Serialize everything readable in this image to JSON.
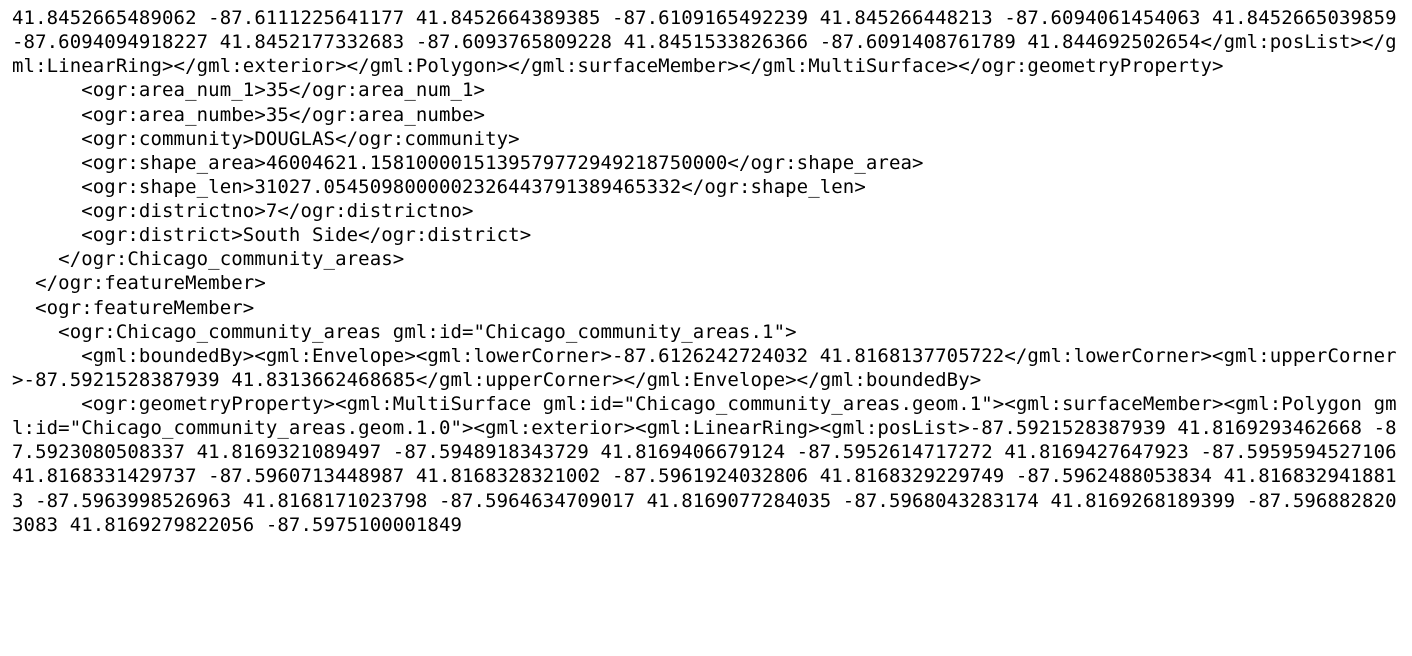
{
  "xml_fragment_lines": [
    "41.8452665489062 -87.6111225641177 41.8452664389385 -87.6109165492239 41.845266448213 -87.6094061454063 41.8452665039859 -87.6094094918227 41.8452177332683 -87.6093765809228 41.8451533826366 -87.6091408761789 41.844692502654</gml:posList></gml:LinearRing></gml:exterior></gml:Polygon></gml:surfaceMember></gml:MultiSurface></ogr:geometryProperty>",
    "      <ogr:area_num_1>35</ogr:area_num_1>",
    "      <ogr:area_numbe>35</ogr:area_numbe>",
    "      <ogr:community>DOUGLAS</ogr:community>",
    "      <ogr:shape_area>46004621.1581000015139579772949218750000</ogr:shape_area>",
    "      <ogr:shape_len>31027.0545098000002326443791389465332</ogr:shape_len>",
    "      <ogr:districtno>7</ogr:districtno>",
    "      <ogr:district>South Side</ogr:district>",
    "    </ogr:Chicago_community_areas>",
    "  </ogr:featureMember>",
    "  <ogr:featureMember>",
    "    <ogr:Chicago_community_areas gml:id=\"Chicago_community_areas.1\">",
    "      <gml:boundedBy><gml:Envelope><gml:lowerCorner>-87.6126242724032 41.8168137705722</gml:lowerCorner><gml:upperCorner>-87.5921528387939 41.8313662468685</gml:upperCorner></gml:Envelope></gml:boundedBy>",
    "      <ogr:geometryProperty><gml:MultiSurface gml:id=\"Chicago_community_areas.geom.1\"><gml:surfaceMember><gml:Polygon gml:id=\"Chicago_community_areas.geom.1.0\"><gml:exterior><gml:LinearRing><gml:posList>-87.5921528387939 41.8169293462668 -87.5923080508337 41.8169321089497 -87.5948918343729 41.8169406679124 -87.5952614717272 41.8169427647923 -87.5959594527106 41.8168331429737 -87.5960713448987 41.8168328321002 -87.5961924032806 41.8168329229749 -87.5962488053834 41.8168329418813 -87.5963998526963 41.8168171023798 -87.5964634709017 41.8169077284035 -87.5968043283174 41.8169268189399 -87.5968828203083 41.8169279822056 -87.5975100001849"
  ],
  "feature0": {
    "area_num_1": "35",
    "area_numbe": "35",
    "community": "DOUGLAS",
    "shape_area": "46004621.1581000015139579772949218750000",
    "shape_len": "31027.0545098000002326443791389465332",
    "districtno": "7",
    "district": "South Side"
  },
  "feature1": {
    "gml_id": "Chicago_community_areas.1",
    "lowerCorner": "-87.6126242724032 41.8168137705722",
    "upperCorner": "-87.5921528387939 41.8313662468685",
    "multiSurface_id": "Chicago_community_areas.geom.1",
    "polygon_id": "Chicago_community_areas.geom.1.0"
  }
}
